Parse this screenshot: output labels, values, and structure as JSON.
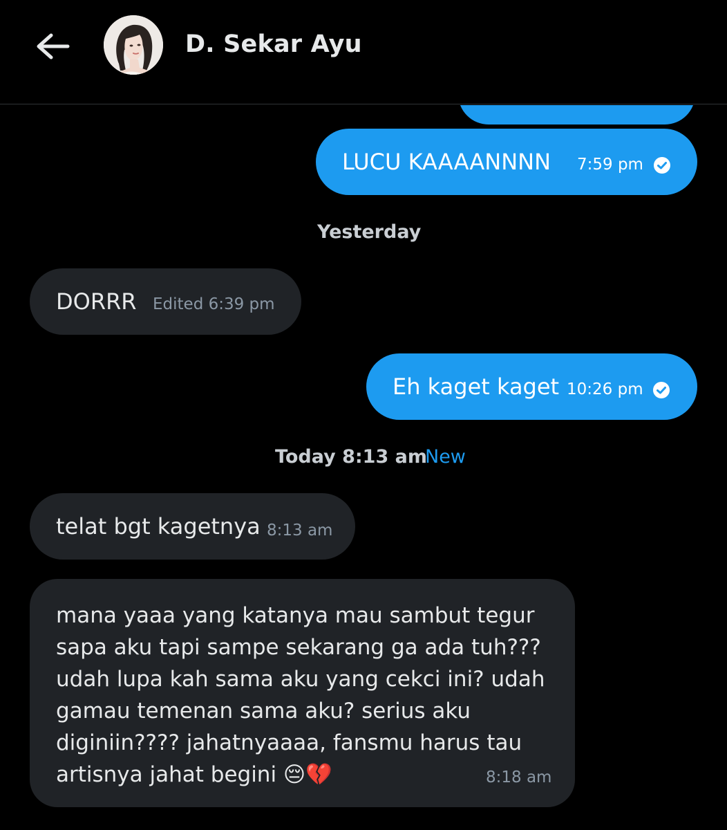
{
  "header": {
    "back_icon": "arrow-left-icon",
    "contact_name": "D. Sekar Ayu"
  },
  "colors": {
    "background": "#000000",
    "outgoing_bubble": "#1d9bf0",
    "incoming_bubble": "#202327",
    "accent": "#1d9bf0"
  },
  "messages": [
    {
      "direction": "out",
      "text": "LUCU KAAAANNNN",
      "time": "7:59 pm",
      "status_icon": "check-circle-icon"
    },
    {
      "type": "separator",
      "label": "Yesterday"
    },
    {
      "direction": "in",
      "text": "DORRR",
      "time": "Edited 6:39 pm"
    },
    {
      "direction": "out",
      "text": "Eh kaget kaget",
      "time": "10:26 pm",
      "status_icon": "check-circle-icon"
    },
    {
      "type": "separator",
      "label": "Today 8:13 am",
      "new_label": "New"
    },
    {
      "direction": "in",
      "text": "telat bgt kagetnya",
      "time": "8:13 am"
    },
    {
      "direction": "in",
      "text": "mana yaaa yang katanya mau sambut tegur\nsapa aku tapi sampe sekarang ga ada tuh???\nudah lupa kah sama aku yang cekci ini? udah\ngamau temenan sama aku? serius aku\ndiginiin???? jahatnyaaaa, fansmu harus tau\nartisnya jahat begini 😔💔",
      "time": "8:18 am"
    }
  ]
}
